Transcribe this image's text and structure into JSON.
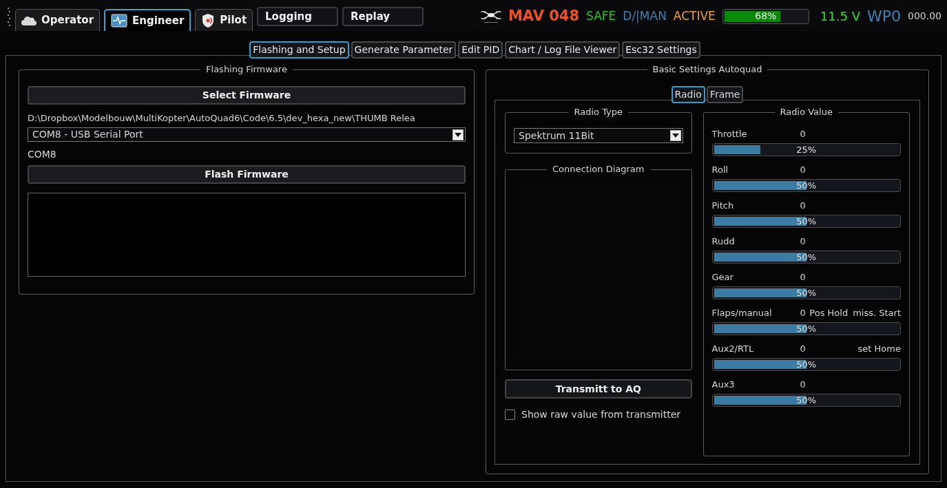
{
  "top_tabs": [
    {
      "label": "Operator",
      "kind": "tab",
      "selected": false
    },
    {
      "label": "Engineer",
      "kind": "tab",
      "selected": true
    },
    {
      "label": "Pilot",
      "kind": "tab",
      "selected": false
    },
    {
      "label": "Logging",
      "kind": "button"
    },
    {
      "label": "Replay",
      "kind": "button"
    }
  ],
  "status": {
    "items": [
      {
        "text": "MAV 048",
        "color": "#e8522a",
        "kind": "big"
      },
      {
        "text": "SAFE",
        "color": "#2fbf2f",
        "kind": "text"
      },
      {
        "text": "D/|MAN",
        "color": "#3f7fb0",
        "kind": "text"
      },
      {
        "text": "ACTIVE",
        "color": "#e8a040",
        "kind": "text"
      }
    ],
    "battery": {
      "level": 0.68,
      "reading": "68%"
    },
    "voltage": "11.5 V",
    "waypoint": "WP0",
    "distance": "000.00"
  },
  "sub_tabs": [
    {
      "label": "Flashing and Setup",
      "selected": true
    },
    {
      "label": "Generate Parameter",
      "selected": false
    },
    {
      "label": "Edit PID",
      "selected": false
    },
    {
      "label": "Chart / Log File Viewer",
      "selected": false
    },
    {
      "label": "Esc32 Settings",
      "selected": false
    }
  ],
  "flashing": {
    "title": "Flashing Firmware",
    "select_button": "Select Firmware",
    "path": "D:\\Dropbox\\Modelbouw\\MultiKopter\\AutoQuad6\\Code\\6.5\\dev_hexa_new\\THUMB Relea",
    "port": "COM8 - USB Serial Port",
    "port_label": "COM8",
    "flash_button": "Flash Firmware"
  },
  "settings": {
    "title": "Basic Settings Autoquad",
    "tabs": [
      {
        "label": "Radio",
        "selected": true
      },
      {
        "label": "Frame",
        "selected": false
      }
    ],
    "radio_type": {
      "title": "Radio Type",
      "value": "Spektrum 11Bit"
    },
    "diagram": {
      "title": "Connection Diagram"
    },
    "transmit_button": "Transmitt to AQ",
    "raw_checkbox": {
      "label": "Show raw value from transmitter",
      "checked": false
    },
    "radio_value": {
      "title": "Radio Value",
      "channels": [
        {
          "name": "Throttle",
          "value": "0",
          "level": 0.25,
          "reading": "25%"
        },
        {
          "name": "Roll",
          "value": "0",
          "level": 0.5,
          "reading": "50%"
        },
        {
          "name": "Pitch",
          "value": "0",
          "level": 0.5,
          "reading": "50%"
        },
        {
          "name": "Rudd",
          "value": "0",
          "level": 0.5,
          "reading": "50%"
        },
        {
          "name": "Gear",
          "value": "0",
          "level": 0.5,
          "reading": "50%"
        },
        {
          "name": "Flaps/manual",
          "value": "0",
          "notes": [
            "Pos Hold",
            "miss. Start"
          ],
          "level": 0.5,
          "reading": "50%"
        },
        {
          "name": "Aux2/RTL",
          "value": "0",
          "notes": [
            "set Home"
          ],
          "level": 0.5,
          "reading": "50%"
        },
        {
          "name": "Aux3",
          "value": "0",
          "level": 0.5,
          "reading": "50%"
        }
      ]
    }
  }
}
